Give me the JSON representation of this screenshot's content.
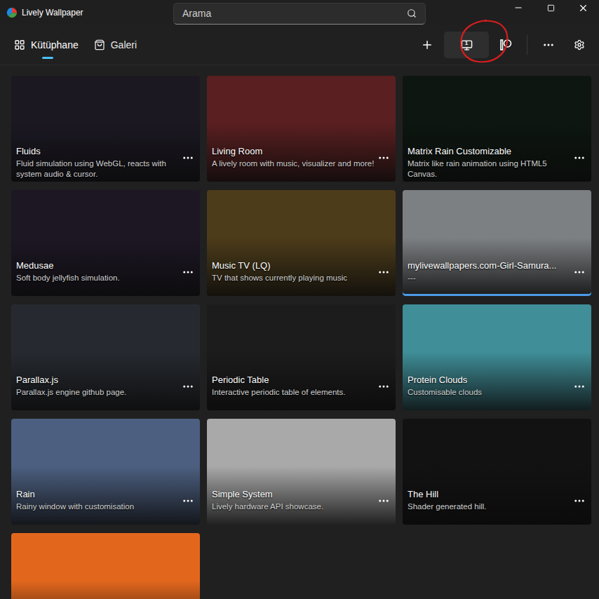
{
  "window": {
    "title": "Lively Wallpaper"
  },
  "search": {
    "placeholder": "Arama"
  },
  "tabs": [
    {
      "label": "Kütüphane",
      "selected": true
    },
    {
      "label": "Galeri",
      "selected": false
    }
  ],
  "toolbar": {
    "monitor_number": "1",
    "monitor_selected": true
  },
  "wallpapers": [
    {
      "title": "Fluids",
      "description": "Fluid simulation using WebGL, reacts with system audio & cursor.",
      "selected": false,
      "color": "#1b1822"
    },
    {
      "title": "Living Room",
      "description": "A lively room with music, visualizer and more!",
      "selected": false,
      "color": "#5a1f20"
    },
    {
      "title": "Matrix Rain Customizable",
      "description": "Matrix like rain animation using HTML5 Canvas.",
      "selected": false,
      "color": "#0d1610"
    },
    {
      "title": "Medusae",
      "description": "Soft body jellyfish simulation.",
      "selected": false,
      "color": "#1d1724"
    },
    {
      "title": "Music TV (LQ)",
      "description": "TV that shows currently playing music",
      "selected": false,
      "color": "#4d3c1a"
    },
    {
      "title": "mylivewallpapers.com-Girl-Samura...",
      "description": "---",
      "selected": true,
      "color": "#7d8083"
    },
    {
      "title": "Parallax.js",
      "description": "Parallax.js engine github page.",
      "selected": false,
      "color": "#262a30"
    },
    {
      "title": "Periodic Table",
      "description": "Interactive periodic table of elements.",
      "selected": false,
      "color": "#1c1c1c"
    },
    {
      "title": "Protein Clouds",
      "description": "Customisable clouds",
      "selected": false,
      "color": "#3f8e98"
    },
    {
      "title": "Rain",
      "description": "Rainy window with customisation",
      "selected": false,
      "color": "#4c5f80"
    },
    {
      "title": "Simple System",
      "description": "Lively hardware API showcase.",
      "selected": false,
      "color": "#a9a9a9"
    },
    {
      "title": "The Hill",
      "description": "Shader generated hill.",
      "selected": false,
      "color": "#121212"
    },
    {
      "title": "",
      "description": "",
      "selected": false,
      "color": "#e2671d"
    }
  ]
}
